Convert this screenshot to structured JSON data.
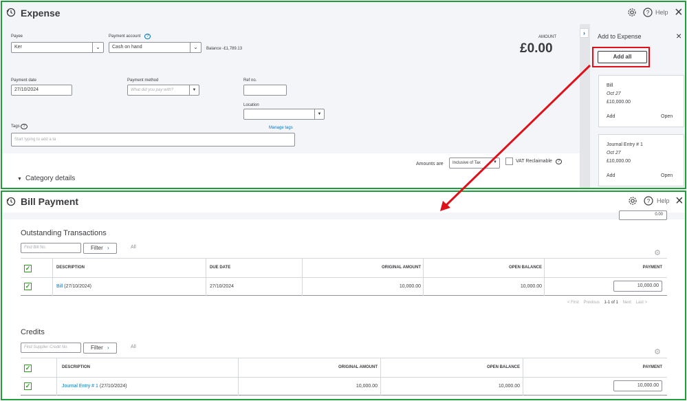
{
  "expense": {
    "title": "Expense",
    "help": "Help",
    "payee_label": "Payee",
    "payee_value": "Ker",
    "payment_account_label": "Payment account",
    "payment_account_value": "Cash on hand",
    "balance": "Balance -£1,789.13",
    "amount_label": "AMOUNT",
    "amount_value": "£0.00",
    "payment_date_label": "Payment date",
    "payment_date_value": "27/10/2024",
    "payment_method_label": "Payment method",
    "payment_method_placeholder": "What did you pay with?",
    "ref_label": "Ref no.",
    "location_label": "Location",
    "tags_label": "Tags",
    "manage_tags": "Manage tags",
    "tags_placeholder": "Start typing to add a ta",
    "amounts_are_label": "Amounts are",
    "amounts_are_value": "Inclusive of Tax",
    "vat_label": "VAT Reclaimable",
    "category_details": "Category details"
  },
  "side_panel": {
    "title": "Add to Expense",
    "add_all": "Add all",
    "cards": [
      {
        "type": "Bill",
        "date": "Oct 27",
        "amount": "£10,000.00",
        "add": "Add",
        "open": "Open"
      },
      {
        "type": "Journal Entry # 1",
        "date": "Oct 27",
        "amount": "£10,000.00",
        "add": "Add",
        "open": "Open"
      }
    ]
  },
  "bill_payment": {
    "title": "Bill Payment",
    "help": "Help",
    "top_amount": "0.00",
    "outstanding": {
      "title": "Outstanding Transactions",
      "search_placeholder": "Find Bill No.",
      "filter": "Filter",
      "all": "All",
      "headers": [
        "DESCRIPTION",
        "DUE DATE",
        "ORIGINAL AMOUNT",
        "OPEN BALANCE",
        "PAYMENT"
      ],
      "row": {
        "desc_link": "Bill",
        "desc_rest": "(27/10/2024)",
        "due": "27/10/2024",
        "original": "10,000.00",
        "open": "10,000.00",
        "payment": "10,000.00"
      },
      "pagination": {
        "first": "< First",
        "previous": "Previous",
        "range": "1-1 of 1",
        "next": "Next",
        "last": "Last >"
      }
    },
    "credits": {
      "title": "Credits",
      "search_placeholder": "Find Supplier Credit No.",
      "filter": "Filter",
      "all": "All",
      "headers": [
        "DESCRIPTION",
        "ORIGINAL AMOUNT",
        "OPEN BALANCE",
        "PAYMENT"
      ],
      "row": {
        "desc_link": "Journal Entry # 1",
        "desc_rest": "(27/10/2024)",
        "original": "10,000.00",
        "open": "10,000.00",
        "payment": "10,000.00"
      }
    }
  },
  "colors": {
    "frame": "#1e9e3a",
    "arrow": "#e0101a",
    "link": "#0077c5",
    "check": "#2ca01c"
  }
}
